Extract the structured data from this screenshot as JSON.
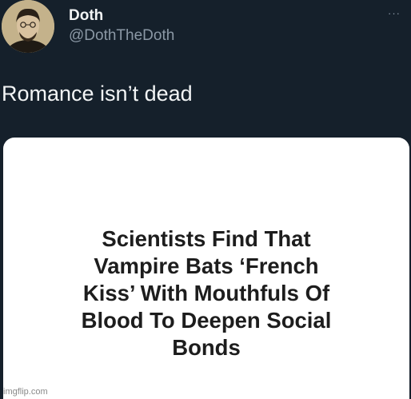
{
  "tweet": {
    "author_name": "Doth",
    "author_handle": "@DothTheDoth",
    "more_label": "···",
    "text": "Romance isn’t dead"
  },
  "media": {
    "headline": "Scientists Find That\nVampire Bats ‘French\nKiss’ With Mouthfuls Of\nBlood To Deepen Social\nBonds"
  },
  "watermark": {
    "text": "imgflip.com"
  },
  "icons": {
    "avatar": "portrait-photo",
    "more": "more-options-icon"
  },
  "colors": {
    "background": "#15202b",
    "primary_text": "#f2f4f5",
    "secondary_text": "#8b98a5",
    "card_background": "#ffffff",
    "headline_text": "#1d1d1d"
  }
}
